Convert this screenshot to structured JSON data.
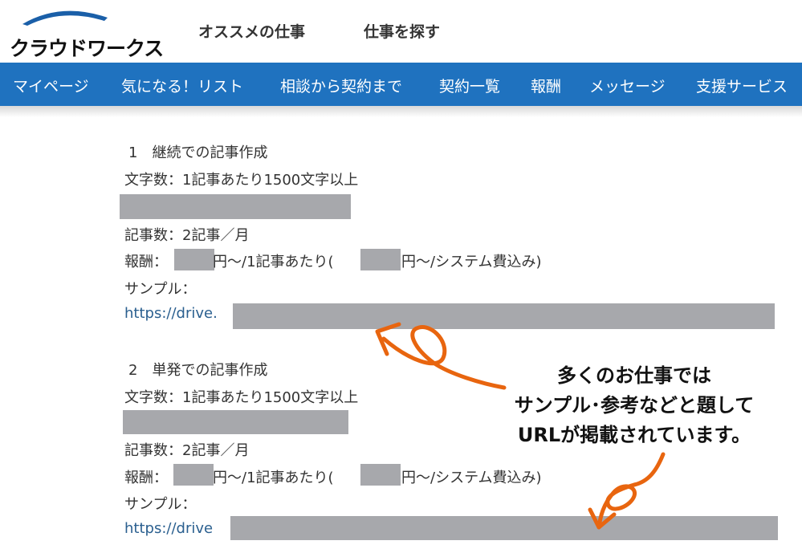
{
  "header": {
    "logo_text": "クラウドワークス",
    "links": [
      "オススメの仕事",
      "仕事を探す"
    ]
  },
  "nav": {
    "items": [
      "マイページ",
      "気になる！リスト",
      "相談から契約まで",
      "契約一覧",
      "報酬",
      "メッセージ",
      "支援サービス"
    ]
  },
  "jobs": [
    {
      "title": "1　継続での記事作成",
      "chars": "文字数：1記事あたり1500文字以上",
      "count": "記事数：2記事／月",
      "reward_label": "報酬：",
      "reward_mid": "円〜/1記事あたり(",
      "reward_end": "円〜/システム費込み)",
      "sample_label": "サンプル：",
      "url_prefix": "https://drive."
    },
    {
      "title": "2　単発での記事作成",
      "chars": "文字数：1記事あたり1500文字以上",
      "count": "記事数：2記事／月",
      "reward_label": "報酬：",
      "reward_mid": "円〜/1記事あたり(",
      "reward_end": "円〜/システム費込み)",
      "sample_label": "サンプル：",
      "url_prefix": "https://drive"
    }
  ],
  "annotation": {
    "lines": [
      "多くのお仕事では",
      "サンプル･参考などと題して",
      "URLが掲載されています。"
    ]
  },
  "colors": {
    "nav_bg": "#1f72bf",
    "logo_arc": "#1a5fa8",
    "arrow": "#e8650f",
    "redaction": "#a7a8ac",
    "link": "#2a5f8f"
  }
}
